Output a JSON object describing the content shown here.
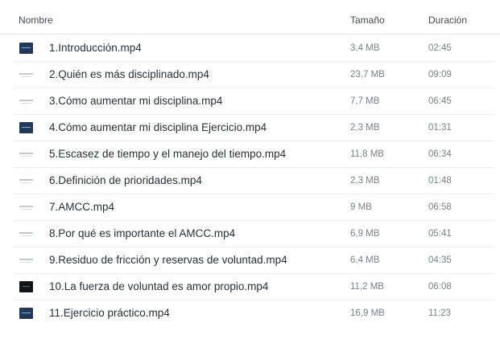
{
  "columns": {
    "name": "Nombre",
    "size": "Tamaño",
    "duration": "Duración"
  },
  "files": [
    {
      "name": "1.Introducción.mp4",
      "size": "3,4 MB",
      "duration": "02:45",
      "thumb": "dark"
    },
    {
      "name": "2.Quién es más disciplinado.mp4",
      "size": "23,7 MB",
      "duration": "09:09",
      "thumb": "light"
    },
    {
      "name": "3.Cómo aumentar mi disciplina.mp4",
      "size": "7,7 MB",
      "duration": "06:45",
      "thumb": "light"
    },
    {
      "name": "4.Cómo aumentar mi disciplina Ejercicio.mp4",
      "size": "2,3 MB",
      "duration": "01:31",
      "thumb": "dark"
    },
    {
      "name": "5.Escasez de tiempo y el manejo del tiempo.mp4",
      "size": "11,8 MB",
      "duration": "06:34",
      "thumb": "light"
    },
    {
      "name": "6.Definición de prioridades.mp4",
      "size": "2,3 MB",
      "duration": "01:48",
      "thumb": "light"
    },
    {
      "name": "7.AMCC.mp4",
      "size": "9 MB",
      "duration": "06:58",
      "thumb": "light"
    },
    {
      "name": "8.Por qué es importante el AMCC.mp4",
      "size": "6,9 MB",
      "duration": "05:41",
      "thumb": "light"
    },
    {
      "name": "9.Residuo de fricción y reservas de voluntad.mp4",
      "size": "6,4 MB",
      "duration": "04:35",
      "thumb": "light"
    },
    {
      "name": "10.La fuerza de voluntad es amor propio.mp4",
      "size": "11,2 MB",
      "duration": "06:08",
      "thumb": "black"
    },
    {
      "name": "11.Ejercicio práctico.mp4",
      "size": "16,9 MB",
      "duration": "11:23",
      "thumb": "dark"
    }
  ]
}
